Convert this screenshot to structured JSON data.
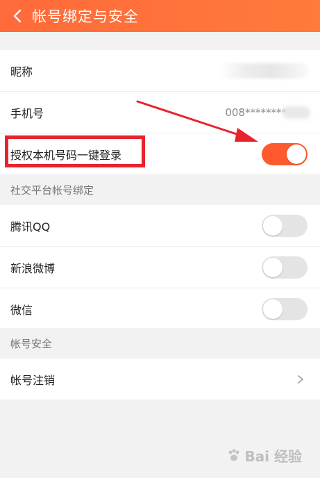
{
  "header": {
    "title": "帐号绑定与安全",
    "back_icon": "chevron-left-icon",
    "color": "#ff6a3a"
  },
  "account": {
    "nickname_label": "昵称",
    "phone_label": "手机号",
    "phone_value": "008********",
    "one_click_login_label": "授权本机号码一键登录",
    "one_click_login_enabled": true
  },
  "social": {
    "section_title": "社交平台帐号绑定",
    "items": [
      {
        "label": "腾讯QQ",
        "enabled": false
      },
      {
        "label": "新浪微博",
        "enabled": false
      },
      {
        "label": "微信",
        "enabled": false
      }
    ]
  },
  "security": {
    "section_title": "帐号安全",
    "cancel_account_label": "帐号注销",
    "chevron_icon": "chevron-right-icon"
  },
  "annotation": {
    "highlight_color": "#e8232c",
    "arrow_color": "#e8232c"
  },
  "watermark": {
    "text": "Bai 经验"
  }
}
